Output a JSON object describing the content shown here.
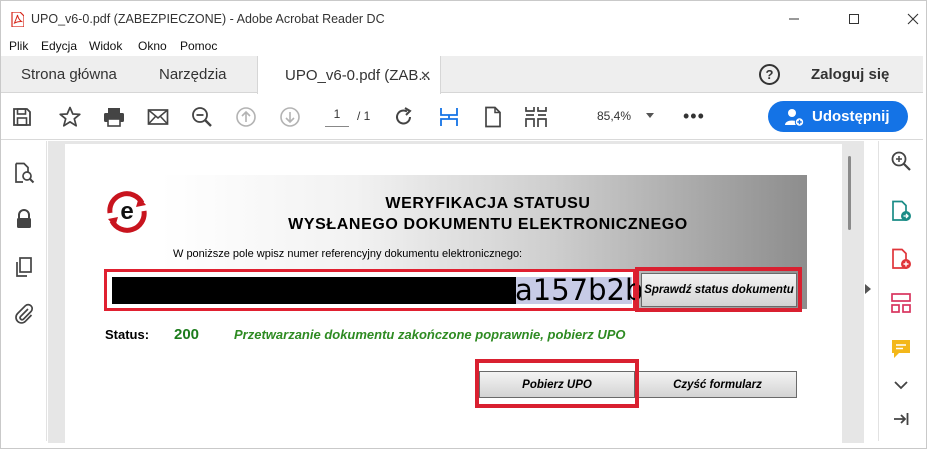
{
  "window": {
    "title": "UPO_v6-0.pdf (ZABEZPIECZONE) - Adobe Acrobat Reader DC"
  },
  "menu": [
    "Plik",
    "Edycja",
    "Widok",
    "Okno",
    "Pomoc"
  ],
  "tabs": {
    "home": "Strona główna",
    "tools": "Narzędzia",
    "doc": "UPO_v6-0.pdf (ZAB...",
    "help": "?",
    "login": "Zaloguj się"
  },
  "toolbar": {
    "page_current": "1",
    "page_total": "/  1",
    "zoom": "85,4%",
    "more": "•••",
    "share": "Udostępnij"
  },
  "form": {
    "heading_line1": "WERYFIKACJA STATUSU",
    "heading_line2": "WYSŁANEGO DOKUMENTU ELEKTRONICZNEGO",
    "instruction": "W poniższe pole wpisz numer referencyjny dokumentu elektronicznego:",
    "reference_visible": "a157b2b",
    "check_button": "Sprawdź status dokumentu",
    "status_label": "Status:",
    "status_code": "200",
    "status_message": "Przetwarzanie dokumentu zakończone poprawnie, pobierz UPO",
    "download_button": "Pobierz UPO",
    "clear_button": "Czyść formularz"
  },
  "colors": {
    "accent_blue": "#1473e6",
    "highlight_red": "#d92030",
    "status_green": "#2e8b22"
  }
}
